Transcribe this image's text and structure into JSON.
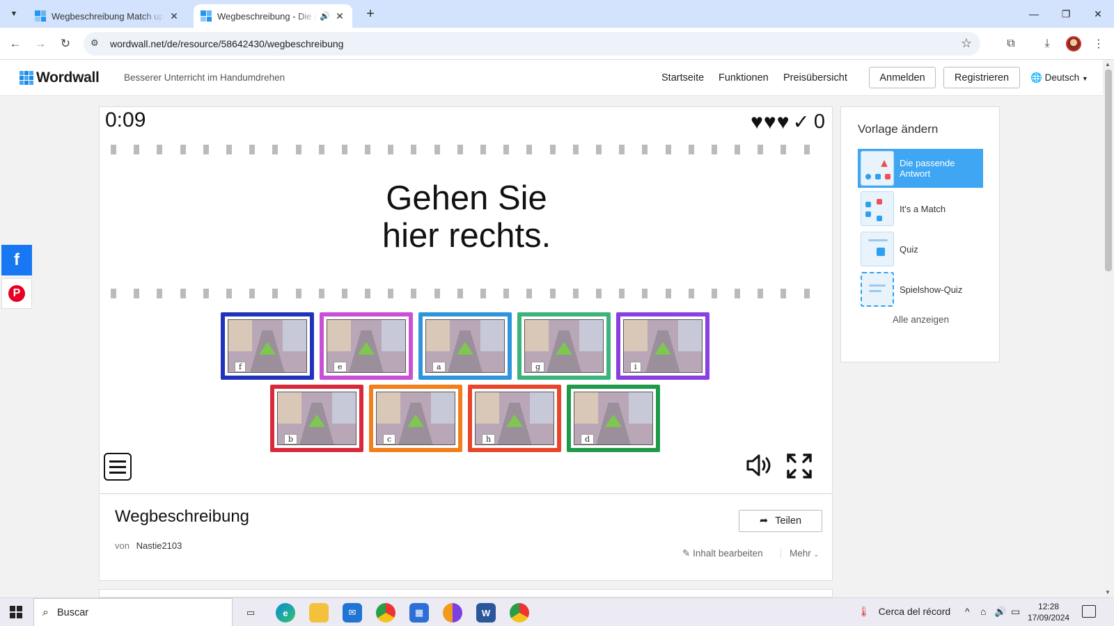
{
  "browser": {
    "tabs": [
      {
        "title": "Wegbeschreibung Match up - W",
        "active": false
      },
      {
        "title": "Wegbeschreibung - Die passende",
        "active": true
      }
    ],
    "url": "wordwall.net/de/resource/58642430/wegbeschreibung"
  },
  "site": {
    "logo": "Wordwall",
    "tagline": "Besserer Unterricht im Handumdrehen",
    "nav": [
      "Startseite",
      "Funktionen",
      "Preisübersicht"
    ],
    "login": "Anmelden",
    "register": "Registrieren",
    "language": "Deutsch"
  },
  "game": {
    "timer": "0:09",
    "lives": 3,
    "score": "0",
    "prompt_line1": "Gehen Sie",
    "prompt_line2": "hier rechts.",
    "cards_row1": [
      {
        "label": "f",
        "color": "#2233bb",
        "arrow": "roundabout-straight"
      },
      {
        "label": "e",
        "color": "#c950d6",
        "arrow": "curve-right"
      },
      {
        "label": "a",
        "color": "#2e95dd",
        "arrow": "straight"
      },
      {
        "label": "g",
        "color": "#3bb37a",
        "arrow": "turn-left"
      },
      {
        "label": "i",
        "color": "#8a3fe0",
        "arrow": "s-curve"
      }
    ],
    "cards_row2": [
      {
        "label": "b",
        "color": "#d92a3c",
        "arrow": "diagonal-left"
      },
      {
        "label": "c",
        "color": "#f27f1b",
        "arrow": "turn-right-crossing"
      },
      {
        "label": "h",
        "color": "#e8452a",
        "arrow": "u-turn"
      },
      {
        "label": "d",
        "color": "#1f9a4a",
        "arrow": "straight"
      }
    ]
  },
  "activity": {
    "title": "Wegbeschreibung",
    "by_label": "von",
    "author": "Nastie2103",
    "share": "Teilen",
    "edit": "Inhalt bearbeiten",
    "more": "Mehr"
  },
  "sidebar": {
    "heading": "Vorlage ändern",
    "templates": [
      {
        "name": "Die passende Antwort",
        "selected": true
      },
      {
        "name": "It's a Match",
        "selected": false
      },
      {
        "name": "Quiz",
        "selected": false
      },
      {
        "name": "Spielshow-Quiz",
        "selected": false
      }
    ],
    "show_all": "Alle anzeigen"
  },
  "taskbar": {
    "search": "Buscar",
    "weather": "Cerca del récord",
    "time": "12:28",
    "date": "17/09/2024"
  }
}
